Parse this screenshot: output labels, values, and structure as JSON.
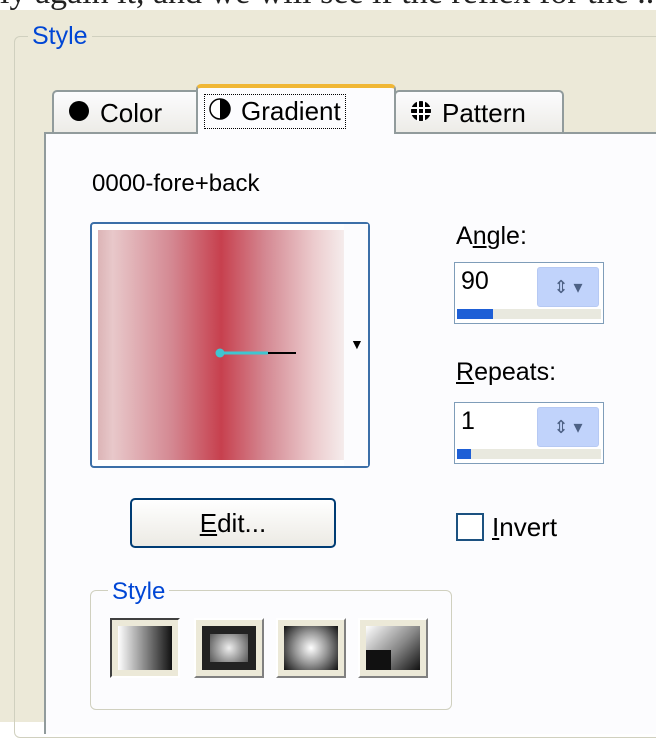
{
  "caption_fragment": "ly again it, and we will see if the reflex for the  ...",
  "outer_group": {
    "legend": "Style"
  },
  "tabs": [
    {
      "label": "Color",
      "icon": "filled-circle-icon"
    },
    {
      "label": "Gradient",
      "icon": "half-circle-icon",
      "active": true
    },
    {
      "label": "Pattern",
      "icon": "pattern-grid-icon"
    }
  ],
  "gradient": {
    "name": "0000-fore+back",
    "colors": {
      "fore": "#c7404e",
      "back": "#f5ecec"
    }
  },
  "angle": {
    "label_pre": "A",
    "label_u": "n",
    "label_post": "gle:",
    "value": "90",
    "level": 0.25
  },
  "repeats": {
    "label_pre": "",
    "label_u": "R",
    "label_post": "epeats:",
    "value": "1",
    "level": 0.1
  },
  "edit_button": {
    "label_u": "E",
    "label_post": "dit..."
  },
  "invert": {
    "label_u": "I",
    "label_post": "nvert",
    "checked": false
  },
  "style_group": {
    "legend": "Style",
    "buttons": [
      {
        "name": "linear-style-icon",
        "pressed": true
      },
      {
        "name": "rectangular-style-icon"
      },
      {
        "name": "radial-style-icon"
      },
      {
        "name": "sunburst-style-icon"
      }
    ]
  }
}
